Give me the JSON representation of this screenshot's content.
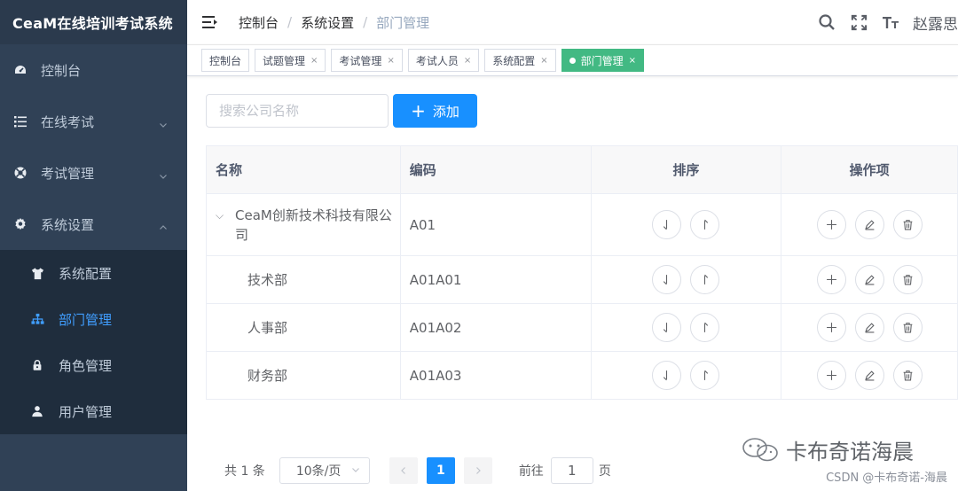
{
  "app": {
    "title": "CeaM在线培训考试系统"
  },
  "sidebar": {
    "items": [
      {
        "label": "控制台",
        "icon": "dashboard-icon"
      },
      {
        "label": "在线考试",
        "icon": "list-icon",
        "arrow": "chevron-down"
      },
      {
        "label": "考试管理",
        "icon": "lifebuoy-icon",
        "arrow": "chevron-down"
      },
      {
        "label": "系统设置",
        "icon": "gear-icon",
        "arrow": "chevron-up"
      }
    ],
    "submenu": [
      {
        "label": "系统配置",
        "icon": "shirt-icon"
      },
      {
        "label": "部门管理",
        "icon": "sitemap-icon",
        "active": true
      },
      {
        "label": "角色管理",
        "icon": "lock-icon"
      },
      {
        "label": "用户管理",
        "icon": "user-icon"
      }
    ]
  },
  "header": {
    "breadcrumb": [
      "控制台",
      "系统设置",
      "部门管理"
    ],
    "username": "赵露思"
  },
  "tags": [
    {
      "label": "控制台",
      "closable": false
    },
    {
      "label": "试题管理",
      "closable": true
    },
    {
      "label": "考试管理",
      "closable": true
    },
    {
      "label": "考试人员",
      "closable": true
    },
    {
      "label": "系统配置",
      "closable": true
    },
    {
      "label": "部门管理",
      "closable": true,
      "active": true
    }
  ],
  "toolbar": {
    "search_placeholder": "搜索公司名称",
    "add_label": "添加"
  },
  "table": {
    "columns": [
      "名称",
      "编码",
      "排序",
      "操作项"
    ],
    "rows": [
      {
        "name": "CeaM创新技术科技有限公司",
        "code": "A01",
        "expandable": true
      },
      {
        "name": "技术部",
        "code": "A01A01"
      },
      {
        "name": "人事部",
        "code": "A01A02"
      },
      {
        "name": "财务部",
        "code": "A01A03"
      }
    ]
  },
  "pagination": {
    "total_text": "共 1 条",
    "page_size": "10条/页",
    "current_page": "1",
    "goto_label": "前往",
    "goto_value": "1",
    "page_unit": "页"
  },
  "watermark": {
    "main": "卡布奇诺海晨",
    "sub": "CSDN @卡布奇诺-海晨"
  },
  "colors": {
    "sidebar_bg": "#304156",
    "primary": "#1890ff",
    "active_tag": "#42b983"
  }
}
